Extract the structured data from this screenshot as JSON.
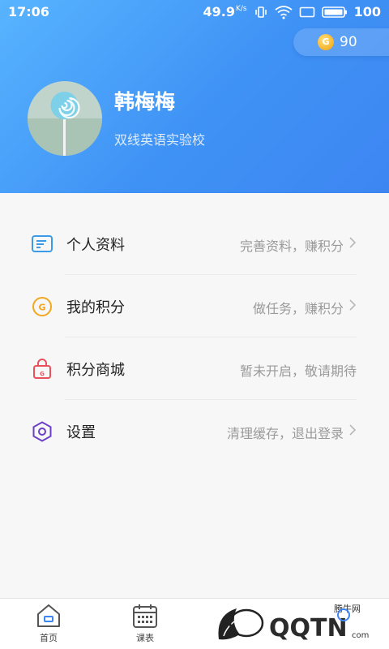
{
  "status_bar": {
    "time": "17:06",
    "net_speed": "49.9",
    "net_unit": "K/s",
    "battery_level": "100"
  },
  "header": {
    "points": "90",
    "coin_letter": "G",
    "user_name": "韩梅梅",
    "school": "双线英语实验校"
  },
  "menu": {
    "items": [
      {
        "icon": "profile-card-icon",
        "label": "个人资料",
        "hint": "完善资料，赚积分"
      },
      {
        "icon": "points-coin-icon",
        "label": "我的积分",
        "hint": "做任务，赚积分"
      },
      {
        "icon": "shopping-bag-icon",
        "label": "积分商城",
        "hint": "暂未开启，敬请期待"
      },
      {
        "icon": "hexagon-settings-icon",
        "label": "设置",
        "hint": "清理缓存，退出登录"
      }
    ]
  },
  "tabbar": {
    "tabs": [
      {
        "label": "首页",
        "icon": "home-icon"
      },
      {
        "label": "课表",
        "icon": "calendar-icon"
      }
    ]
  },
  "watermark": {
    "site": "腾牛网",
    "brand": "QQTN",
    "domain": "com"
  },
  "colors": {
    "header_start": "#58b4ff",
    "header_end": "#3d86f2",
    "coin": "#f7b32b",
    "profile_icon": "#3c9be8",
    "points_icon": "#f0a81f",
    "bag_icon": "#e8505b",
    "settings_icon": "#6a3fc8"
  }
}
